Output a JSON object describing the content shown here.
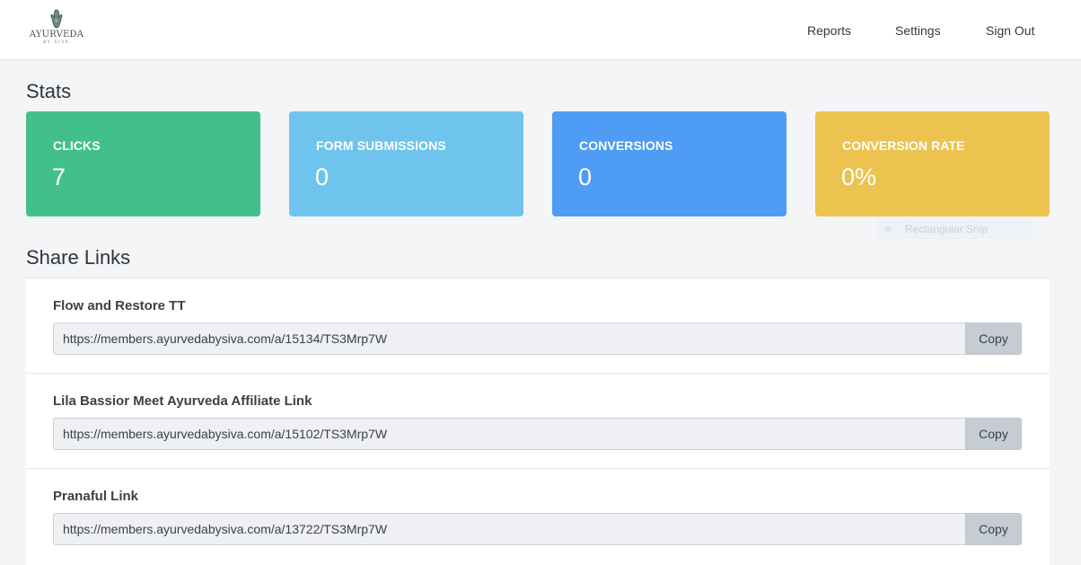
{
  "brand": {
    "name": "AYURVEDA",
    "sub": "BY SIVA",
    "logo_icon": "hamsa-hand-icon"
  },
  "nav": {
    "reports": "Reports",
    "settings": "Settings",
    "sign_out": "Sign Out"
  },
  "stats": {
    "title": "Stats",
    "cards": [
      {
        "label": "CLICKS",
        "value": "7",
        "color": "#43c08a"
      },
      {
        "label": "FORM SUBMISSIONS",
        "value": "0",
        "color": "#6ec4ec"
      },
      {
        "label": "CONVERSIONS",
        "value": "0",
        "color": "#4e9cf4"
      },
      {
        "label": "CONVERSION RATE",
        "value": "0%",
        "color": "#ecc34f"
      }
    ]
  },
  "overlay": {
    "snip_label": "Rectangular Snip"
  },
  "share_links": {
    "title": "Share Links",
    "copy_label": "Copy",
    "items": [
      {
        "name": "Flow and Restore TT",
        "url": "https://members.ayurvedabysiva.com/a/15134/TS3Mrp7W"
      },
      {
        "name": "Lila Bassior Meet Ayurveda Affiliate Link",
        "url": "https://members.ayurvedabysiva.com/a/15102/TS3Mrp7W"
      },
      {
        "name": "Pranaful Link",
        "url": "https://members.ayurvedabysiva.com/a/13722/TS3Mrp7W"
      }
    ]
  }
}
